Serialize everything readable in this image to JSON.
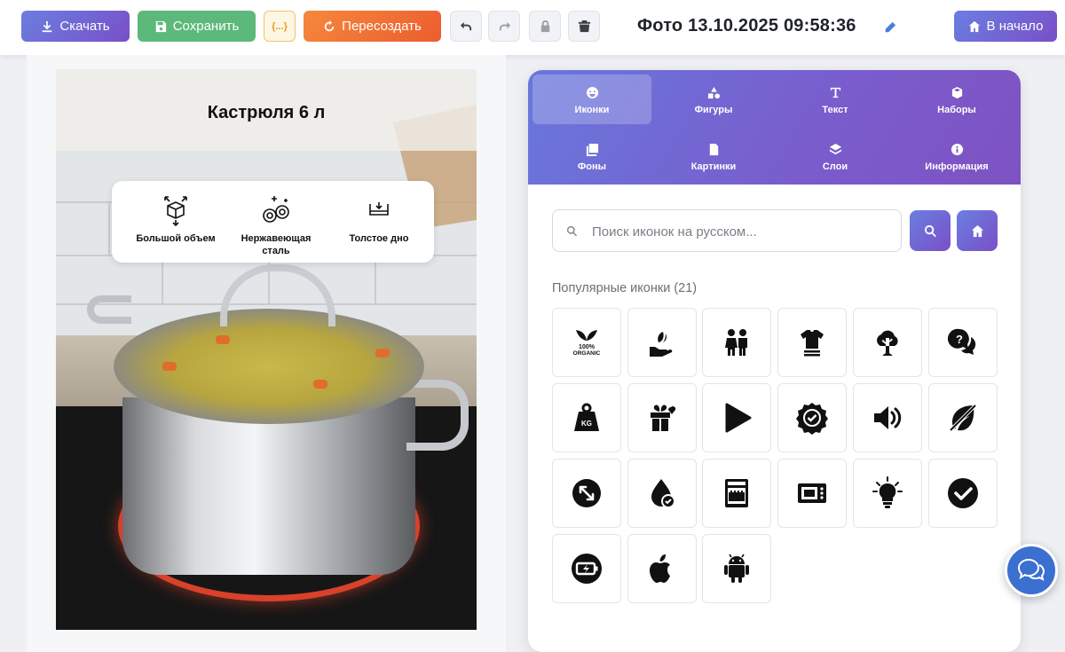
{
  "toolbar": {
    "download_label": "Скачать",
    "save_label": "Сохранить",
    "json_label": "{...}",
    "recreate_label": "Пересоздать",
    "document_title": "Фото 13.10.2025 09:58:36",
    "home_label": "В начало"
  },
  "canvas": {
    "product_title": "Кастрюля 6 л",
    "features": [
      {
        "label": "Большой объем",
        "icon": "box-arrows-icon"
      },
      {
        "label": "Нержавеющая сталь",
        "icon": "sparkle-rings-icon"
      },
      {
        "label": "Толстое дно",
        "icon": "tray-bottom-icon"
      }
    ]
  },
  "panel": {
    "tabs": [
      {
        "label": "Иконки",
        "icon": "smile-icon",
        "active": true
      },
      {
        "label": "Фигуры",
        "icon": "shapes-icon",
        "active": false
      },
      {
        "label": "Текст",
        "icon": "text-icon",
        "active": false
      },
      {
        "label": "Наборы",
        "icon": "cube-icon",
        "active": false
      },
      {
        "label": "Фоны",
        "icon": "images-icon",
        "active": false
      },
      {
        "label": "Картинки",
        "icon": "image-file-icon",
        "active": false
      },
      {
        "label": "Слои",
        "icon": "layers-icon",
        "active": false
      },
      {
        "label": "Информация",
        "icon": "info-icon",
        "active": false
      }
    ],
    "search": {
      "placeholder": "Поиск иконок на русском...",
      "value": ""
    },
    "section_title": "Популярные иконки (21)",
    "icons": [
      {
        "name": "organic-leaf-icon",
        "text": "100%\nORGANIC"
      },
      {
        "name": "hand-leaf-icon"
      },
      {
        "name": "children-icon"
      },
      {
        "name": "tshirt-stack-icon"
      },
      {
        "name": "cloud-tree-icon"
      },
      {
        "name": "question-chat-icon"
      },
      {
        "name": "weight-kg-icon",
        "text": "KG"
      },
      {
        "name": "gift-heart-icon"
      },
      {
        "name": "play-icon"
      },
      {
        "name": "badge-check-icon"
      },
      {
        "name": "volume-icon"
      },
      {
        "name": "no-leaf-icon"
      },
      {
        "name": "diagonal-arrows-icon"
      },
      {
        "name": "drop-check-icon"
      },
      {
        "name": "dishwasher-icon"
      },
      {
        "name": "microwave-icon"
      },
      {
        "name": "lightbulb-icon"
      },
      {
        "name": "check-circle-icon"
      },
      {
        "name": "battery-charge-icon"
      },
      {
        "name": "apple-icon"
      },
      {
        "name": "android-icon"
      }
    ]
  },
  "colors": {
    "accent_gradient_start": "#6a7fe0",
    "accent_gradient_end": "#7a4fc8",
    "save_green": "#5cb97b",
    "recreate_orange": "#f6883c",
    "chat_blue": "#3b6fd0"
  }
}
